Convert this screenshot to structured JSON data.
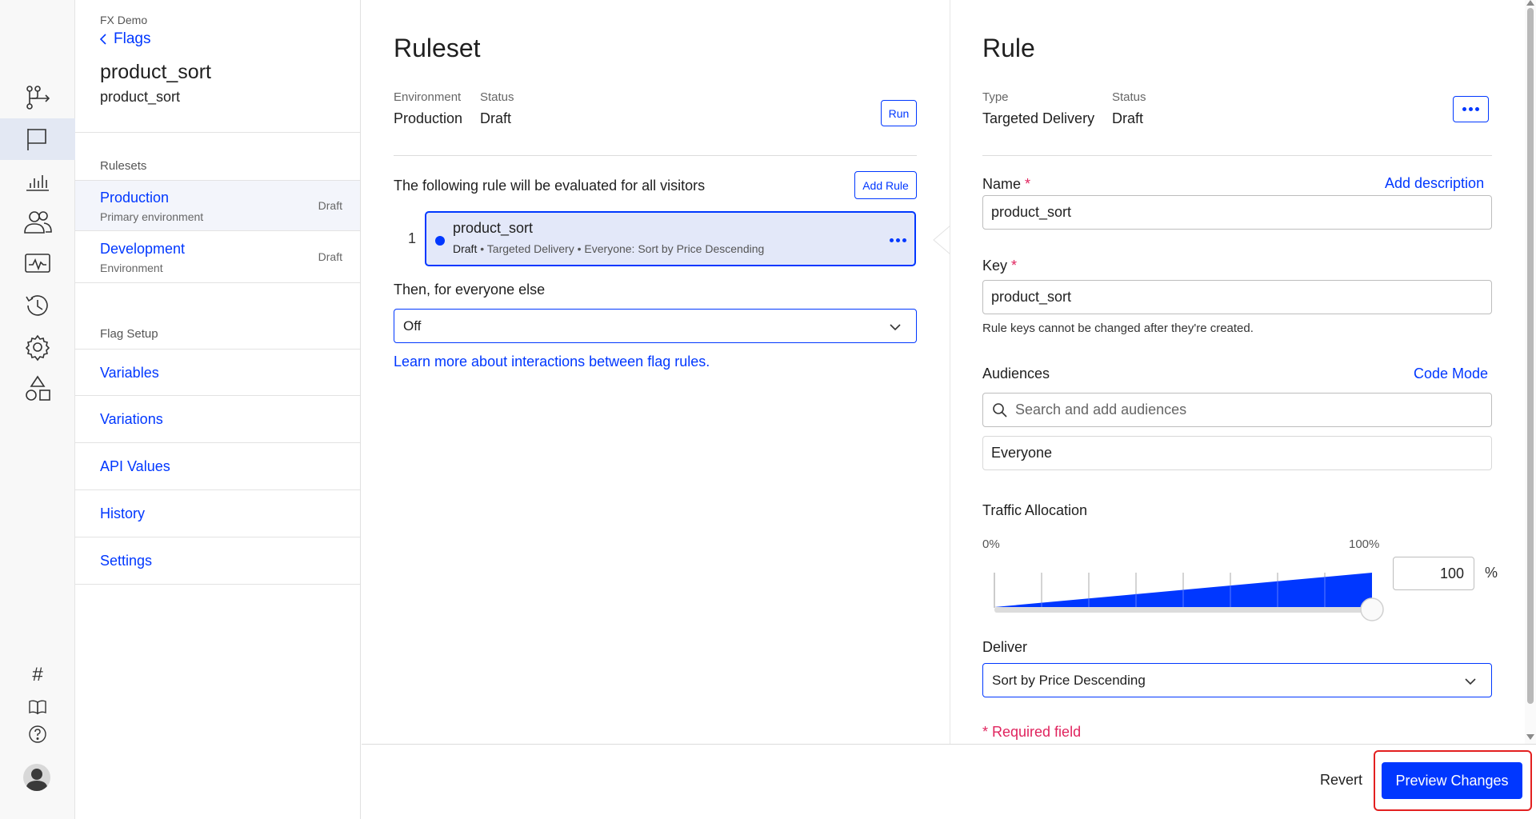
{
  "rail": {
    "items": [
      {
        "icon": "deploy-flow-icon"
      },
      {
        "icon": "flag-icon",
        "active": true
      },
      {
        "icon": "reports-chart-icon"
      },
      {
        "icon": "audiences-icon"
      },
      {
        "icon": "monitor-icon"
      },
      {
        "icon": "history-icon"
      },
      {
        "icon": "settings-gear-icon"
      },
      {
        "icon": "shapes-icon"
      }
    ],
    "bottom": {
      "hash_glyph": "#"
    }
  },
  "flagnav": {
    "project": "FX Demo",
    "back_label": "Flags",
    "flag_name": "product_sort",
    "flag_key": "product_sort",
    "rulesets_heading": "Rulesets",
    "rulesets": [
      {
        "name": "Production",
        "sub": "Primary environment",
        "state": "Draft"
      },
      {
        "name": "Development",
        "sub": "Environment",
        "state": "Draft"
      }
    ],
    "setup_heading": "Flag Setup",
    "setup_items": [
      "Variables",
      "Variations",
      "API Values",
      "History",
      "Settings"
    ]
  },
  "ruleset": {
    "title": "Ruleset",
    "env_label": "Environment",
    "env_value": "Production",
    "status_label": "Status",
    "status_value": "Draft",
    "run_label": "Run",
    "intro": "The following rule will be evaluated for all visitors",
    "add_rule_label": "Add Rule",
    "rule": {
      "index": "1",
      "name": "product_sort",
      "status": "Draft",
      "sep": "•",
      "type": "Targeted Delivery",
      "summary": "Everyone: Sort by Price Descending"
    },
    "else_label": "Then, for everyone else",
    "else_value": "Off",
    "learn_more": "Learn more about interactions between flag rules."
  },
  "rule_panel": {
    "title": "Rule",
    "type_label": "Type",
    "type_value": "Targeted Delivery",
    "status_label": "Status",
    "status_value": "Draft",
    "name_label": "Name",
    "required_mark": "*",
    "add_description": "Add description",
    "name_value": "product_sort",
    "key_label": "Key",
    "key_value": "product_sort",
    "key_help": "Rule keys cannot be changed after they're created.",
    "audiences_label": "Audiences",
    "code_mode": "Code Mode",
    "audience_search_placeholder": "Search and add audiences",
    "audience_selected": "Everyone",
    "traffic_label": "Traffic Allocation",
    "traffic_min": "0%",
    "traffic_max": "100%",
    "traffic_value": "100",
    "traffic_unit": "%",
    "deliver_label": "Deliver",
    "deliver_value": "Sort by Price Descending",
    "required_note": "* Required field"
  },
  "footer": {
    "revert": "Revert",
    "preview": "Preview Changes"
  },
  "colors": {
    "accent": "#0037ff",
    "required": "#e0245e",
    "highlight": "#e32020"
  }
}
